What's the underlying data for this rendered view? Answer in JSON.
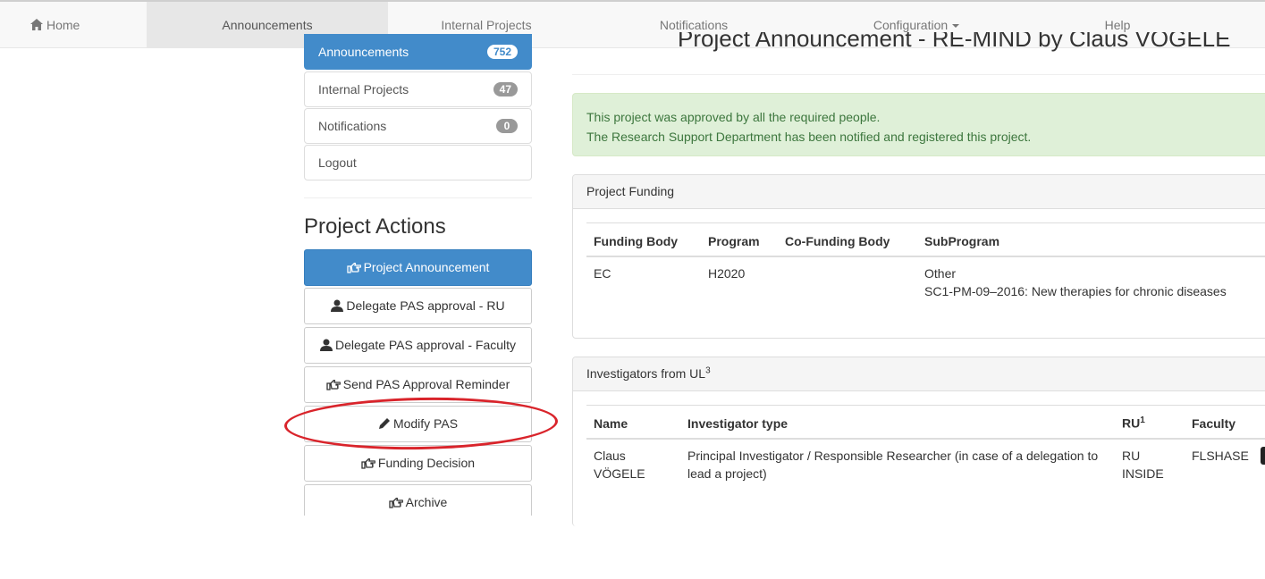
{
  "nav": {
    "home": "Home",
    "announcements": "Announcements",
    "internal_projects": "Internal Projects",
    "notifications": "Notifications",
    "configuration": "Configuration",
    "help": "Help"
  },
  "sidebar": {
    "items": [
      {
        "label": "Announcements",
        "badge": "752"
      },
      {
        "label": "Internal Projects",
        "badge": "47"
      },
      {
        "label": "Notifications",
        "badge": "0"
      },
      {
        "label": "Logout"
      }
    ]
  },
  "actions": {
    "title": "Project Actions",
    "buttons": [
      {
        "label": "Project Announcement",
        "icon": "hand-point-icon"
      },
      {
        "label": "Delegate PAS approval - RU",
        "icon": "user-icon"
      },
      {
        "label": "Delegate PAS approval - Faculty",
        "icon": "user-icon"
      },
      {
        "label": "Send PAS Approval Reminder",
        "icon": "hand-point-icon"
      },
      {
        "label": "Modify PAS",
        "icon": "pencil-icon"
      },
      {
        "label": "Funding Decision",
        "icon": "hand-point-icon"
      },
      {
        "label": "Archive",
        "icon": "hand-point-icon"
      }
    ]
  },
  "page": {
    "heading": "Project Announcement - RE-MIND by Claus VÖGELE"
  },
  "alert": {
    "line1": "This project was approved by all the required people.",
    "line2": "The Research Support Department has been notified and registered this project."
  },
  "funding": {
    "title": "Project Funding",
    "headers": [
      "Funding Body",
      "Program",
      "Co-Funding Body",
      "SubProgram"
    ],
    "row": {
      "funding_body": "EC",
      "program": "H2020",
      "co_funding_body": "",
      "subprogram_line1": "Other",
      "subprogram_line2": "SC1-PM-09–2016: New therapies for chronic diseases"
    }
  },
  "investigators": {
    "title": "Investigators from UL",
    "title_sup": "3",
    "headers": {
      "name": "Name",
      "type": "Investigator type",
      "ru": "RU",
      "ru_sup": "1",
      "faculty": "Faculty"
    },
    "row": {
      "name_line1": "Claus",
      "name_line2": "VÖGELE",
      "type_line1": "Principal Investigator / Responsible Researcher (in case of a delegation to",
      "type_line2": "lead a project)",
      "ru_line1": "RU",
      "ru_line2": "INSIDE",
      "faculty": "FLSHASE"
    }
  },
  "colors": {
    "primary": "#428bca",
    "success_bg": "#dff0d8",
    "success_text": "#3c763d",
    "annotation_circle": "#d9242b"
  }
}
